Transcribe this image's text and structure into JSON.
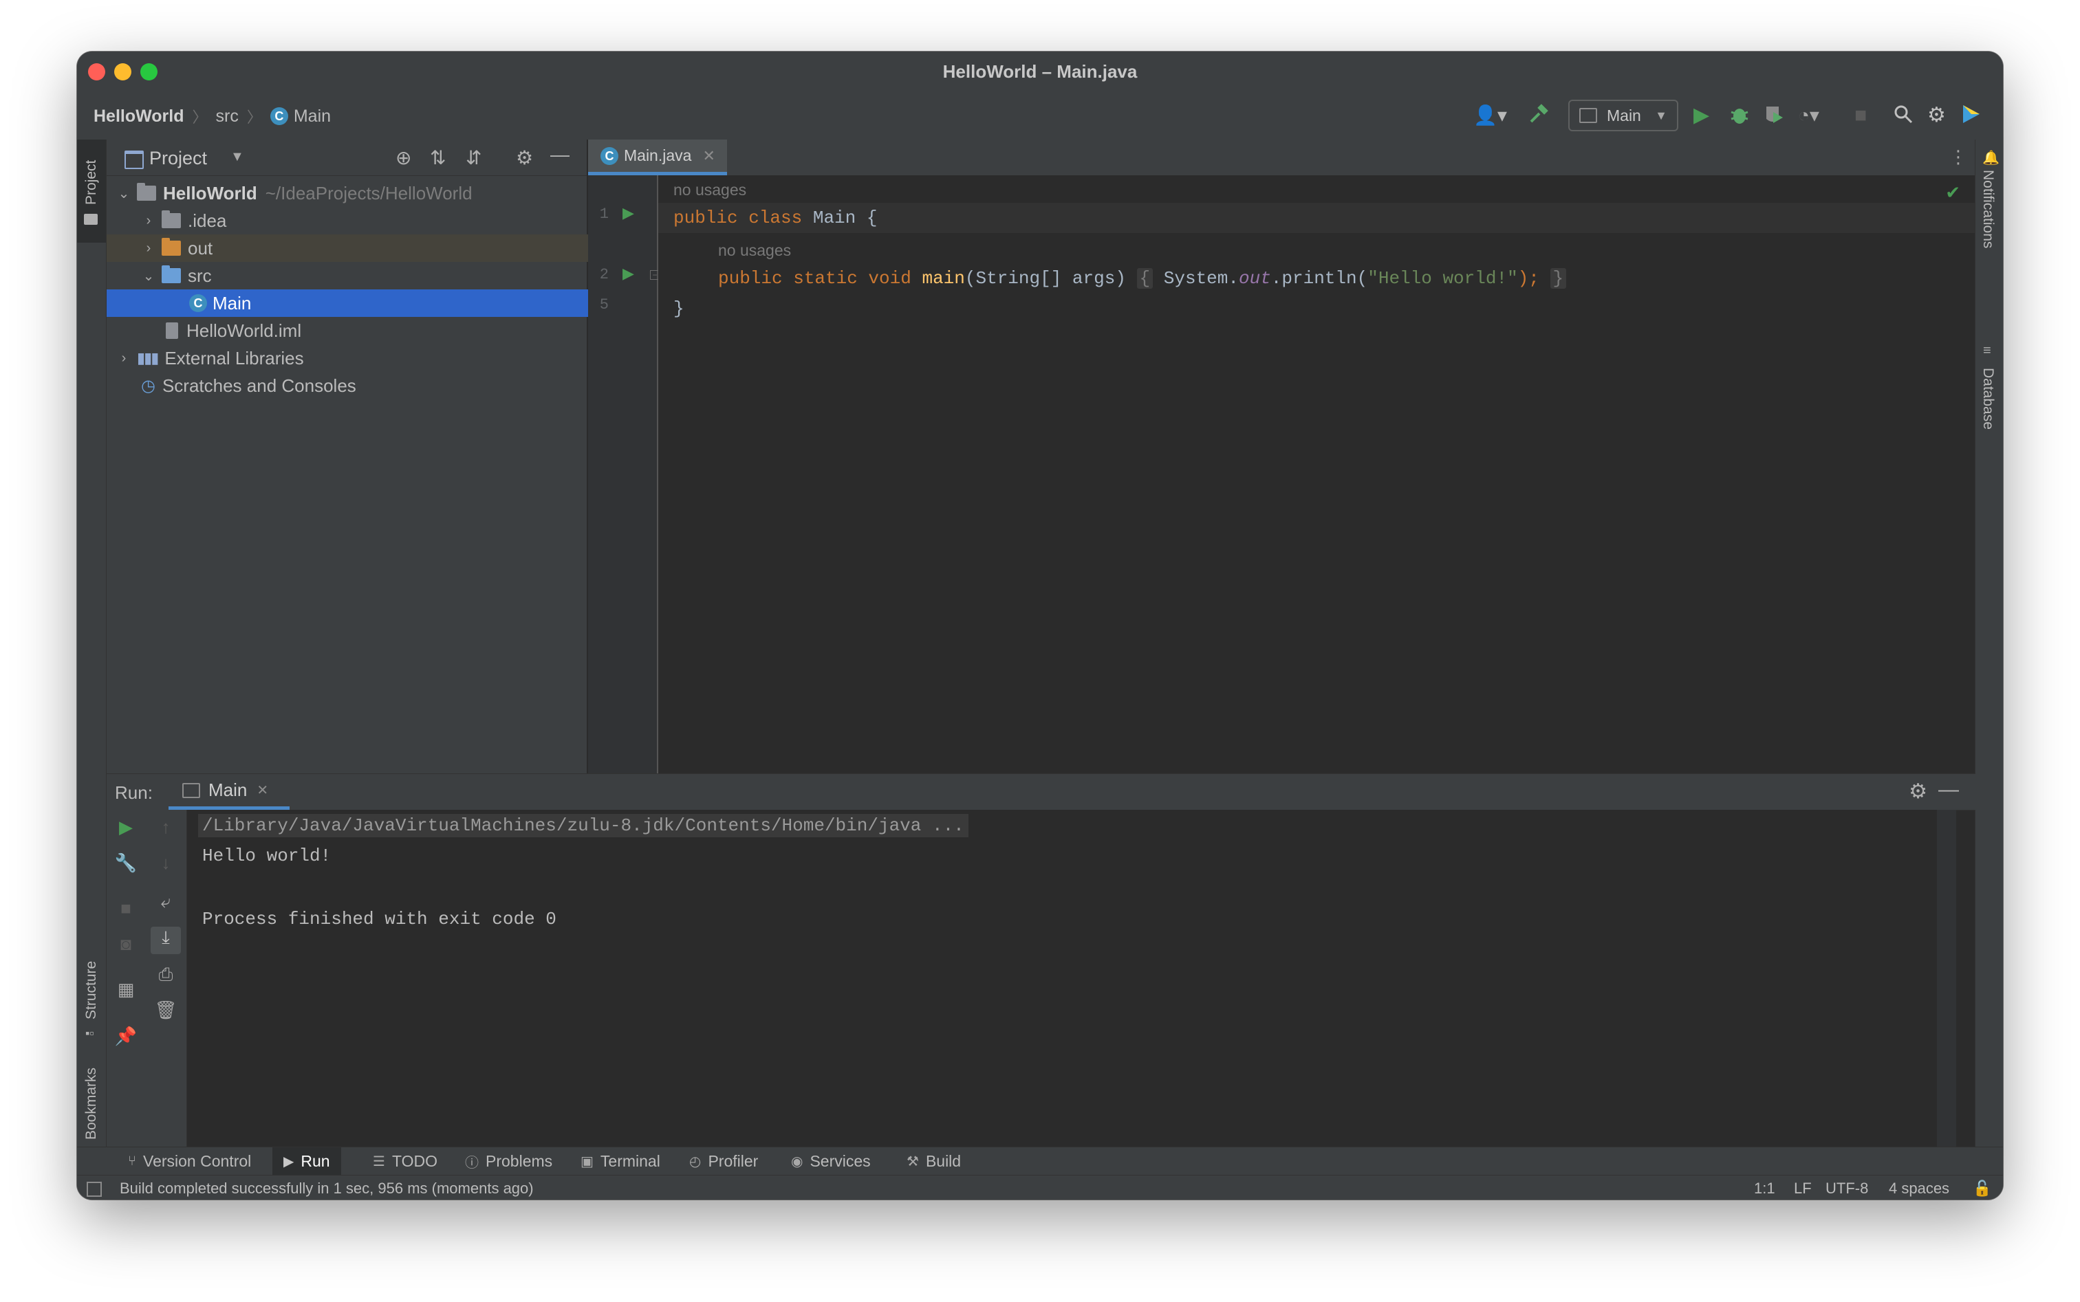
{
  "window": {
    "title": "HelloWorld – Main.java"
  },
  "breadcrumbs": [
    {
      "label": "HelloWorld"
    },
    {
      "label": "src"
    },
    {
      "label": "Main"
    }
  ],
  "toolbar": {
    "run_config": "Main",
    "icons": [
      "user-icon",
      "build-hammer-icon",
      "run-icon",
      "debug-icon",
      "coverage-icon",
      "profile-icon",
      "stop-icon",
      "search-icon",
      "settings-icon",
      "jetbrains-logo-icon"
    ]
  },
  "left_stripe": {
    "project": "Project",
    "structure": "Structure",
    "bookmarks": "Bookmarks"
  },
  "right_stripe": {
    "notifications": "Notifications",
    "database": "Database"
  },
  "project_panel": {
    "title": "Project",
    "tree": [
      {
        "label": "HelloWorld",
        "path": "~/IdeaProjects/HelloWorld",
        "bold": true
      },
      {
        "label": ".idea"
      },
      {
        "label": "out"
      },
      {
        "label": "src"
      },
      {
        "label": "Main",
        "selected": true
      },
      {
        "label": "HelloWorld.iml"
      },
      {
        "label": "External Libraries"
      },
      {
        "label": "Scratches and Consoles"
      }
    ]
  },
  "editor": {
    "tab": "Main.java",
    "hint_usages": "no usages",
    "line_numbers": [
      "1",
      "2",
      "5"
    ],
    "code": {
      "l1_kw": "public class",
      "l1_name": " Main {",
      "l2_kw": "public static void",
      "l2_fn": "main",
      "l2_params": "(String[] args)",
      "l2_open": "{",
      "l2_sys": " System.",
      "l2_out": "out",
      "l2_println": ".println(",
      "l2_str": "\"Hello world!\"",
      "l2_end": ");",
      "l2_close": "}",
      "l3": "}"
    }
  },
  "run_panel": {
    "label": "Run:",
    "tab": "Main",
    "console": {
      "command": "/Library/Java/JavaVirtualMachines/zulu-8.jdk/Contents/Home/bin/java ...",
      "output": "Hello world!",
      "exit": "Process finished with exit code 0"
    }
  },
  "bottom_tabs": [
    {
      "label": "Version Control"
    },
    {
      "label": "Run",
      "active": true
    },
    {
      "label": "TODO"
    },
    {
      "label": "Problems"
    },
    {
      "label": "Terminal"
    },
    {
      "label": "Profiler"
    },
    {
      "label": "Services"
    },
    {
      "label": "Build"
    }
  ],
  "status_bar": {
    "message": "Build completed successfully in 1 sec, 956 ms (moments ago)",
    "position": "1:1",
    "line_sep": "LF",
    "encoding": "UTF-8",
    "indent": "4 spaces"
  },
  "colors": {
    "background": "#2b2b2b",
    "panel": "#3c3f41",
    "selection": "#2f65ca",
    "keyword": "#cc7832",
    "function": "#ffc66d",
    "string": "#6a8759",
    "field": "#9876aa",
    "run_green": "#499c54"
  }
}
